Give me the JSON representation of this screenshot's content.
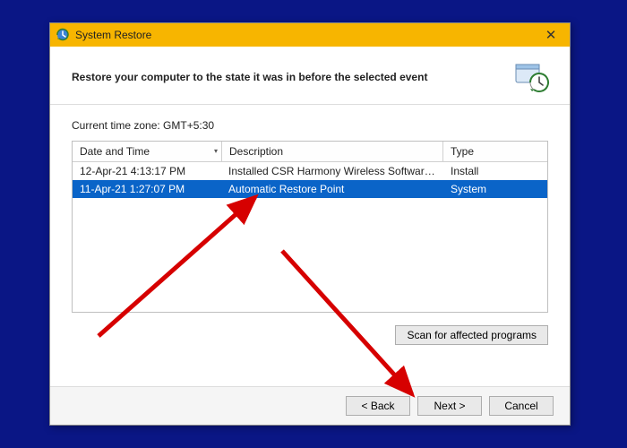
{
  "window": {
    "title": "System Restore",
    "close_glyph": "✕"
  },
  "header": {
    "text": "Restore your computer to the state it was in before the selected event"
  },
  "timezone_label": "Current time zone: GMT+5:30",
  "columns": {
    "date": "Date and Time",
    "desc": "Description",
    "type": "Type"
  },
  "rows": [
    {
      "date": "12-Apr-21 4:13:17 PM",
      "desc": "Installed CSR Harmony Wireless Software Stack.",
      "type": "Install",
      "selected": false
    },
    {
      "date": "11-Apr-21 1:27:07 PM",
      "desc": "Automatic Restore Point",
      "type": "System",
      "selected": true
    }
  ],
  "buttons": {
    "scan": "Scan for affected programs",
    "back": "< Back",
    "next": "Next >",
    "cancel": "Cancel"
  },
  "icons": {
    "title": "restore-icon",
    "header": "restore-clock-icon"
  }
}
